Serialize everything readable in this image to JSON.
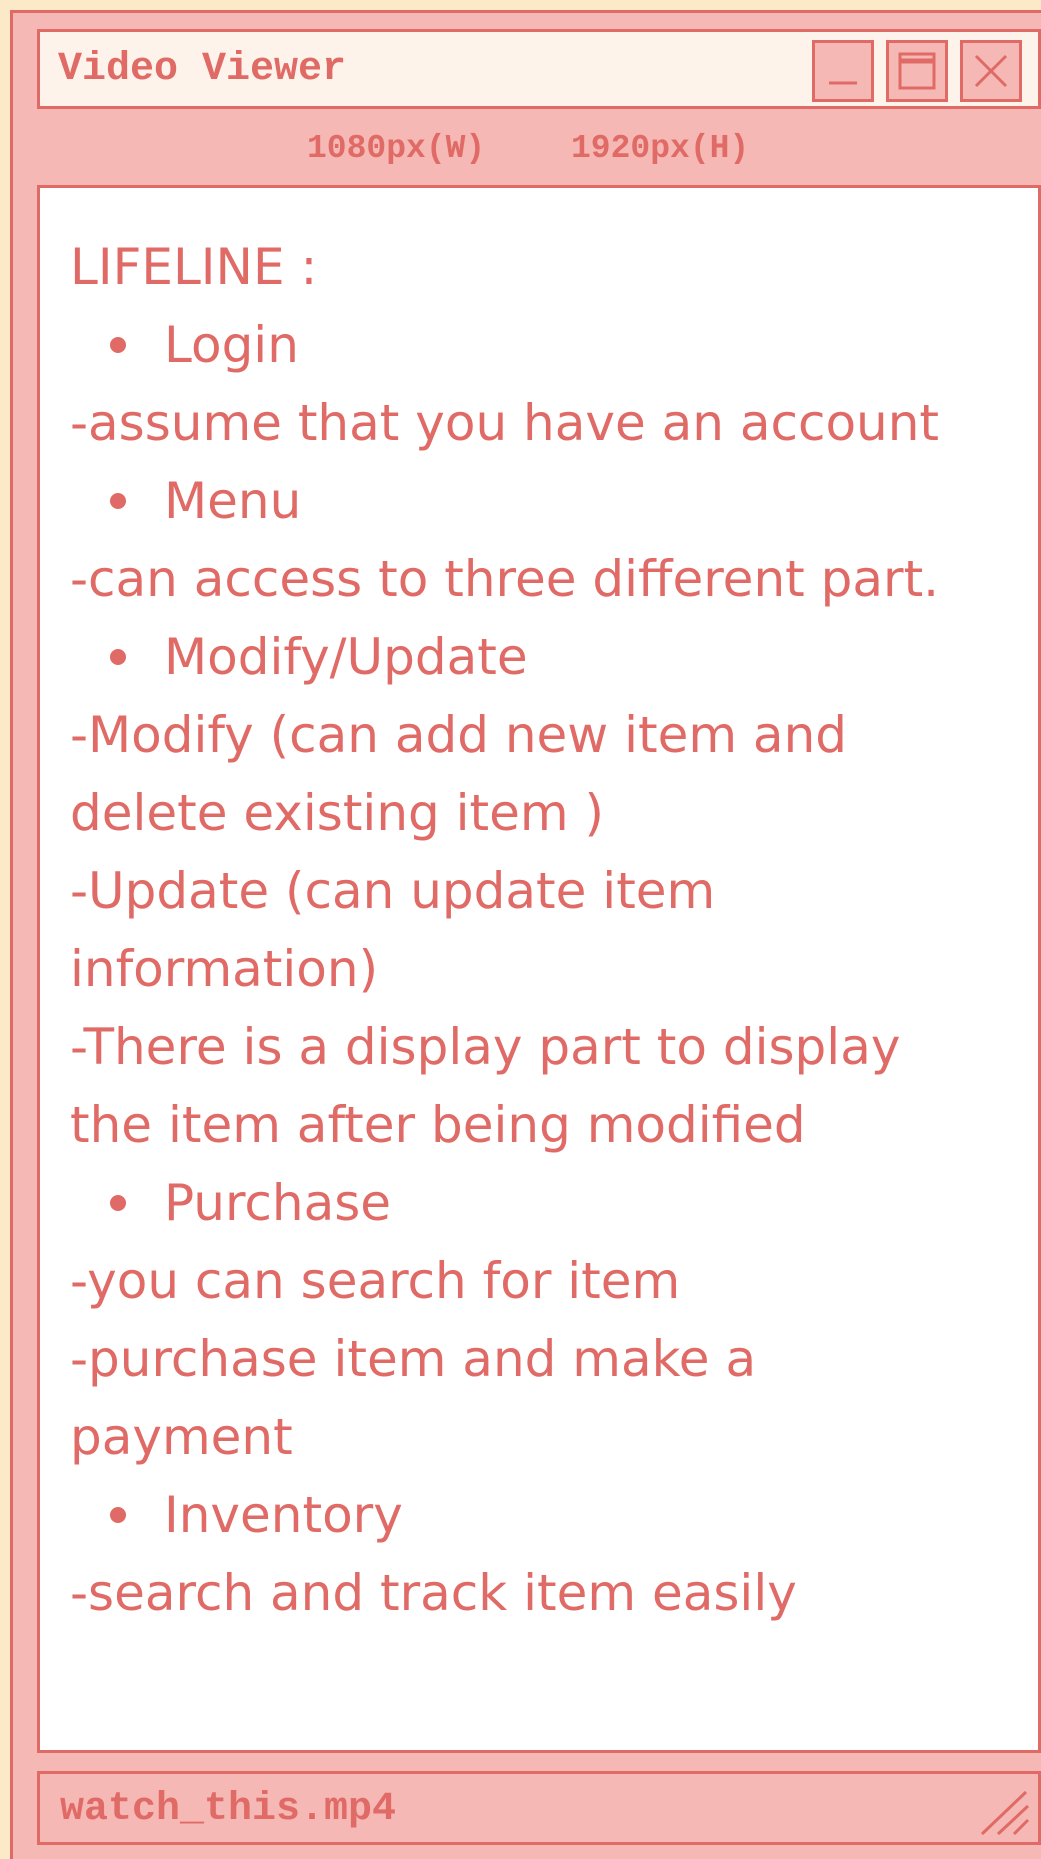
{
  "window": {
    "title": "Video Viewer",
    "controls": [
      "minimize-icon",
      "maximize-icon",
      "close-icon"
    ]
  },
  "dimensions": {
    "width_label": "1080px(W)",
    "height_label": "1920px(H)"
  },
  "content": {
    "lines": [
      {
        "text": "LIFELINE :",
        "bullet": false
      },
      {
        "text": "Login",
        "bullet": true
      },
      {
        "text": "-assume that you have an account",
        "bullet": false
      },
      {
        "text": "Menu",
        "bullet": true
      },
      {
        "text": "-can access to three different part.",
        "bullet": false
      },
      {
        "text": "Modify/Update",
        "bullet": true
      },
      {
        "text": "-Modify (can add new item and",
        "bullet": false
      },
      {
        "text": "delete existing item )",
        "bullet": false
      },
      {
        "text": "-Update (can update item",
        "bullet": false
      },
      {
        "text": "information)",
        "bullet": false
      },
      {
        "text": "-There is a display part to display",
        "bullet": false
      },
      {
        "text": "the item after being modified",
        "bullet": false
      },
      {
        "text": "Purchase",
        "bullet": true
      },
      {
        "text": "-you can search for item",
        "bullet": false
      },
      {
        "text": "-purchase item and make a",
        "bullet": false
      },
      {
        "text": "payment",
        "bullet": false
      },
      {
        "text": "Inventory",
        "bullet": true
      },
      {
        "text": "-search and track item easily",
        "bullet": false
      }
    ]
  },
  "status": {
    "filename": "watch_this.mp4",
    "grip_icon": "resize-grip-icon"
  },
  "colors": {
    "accent": "#e06a66",
    "frame": "#f6b8b5",
    "titlebar": "#fdf3ea",
    "background": "#fbe9c8"
  }
}
